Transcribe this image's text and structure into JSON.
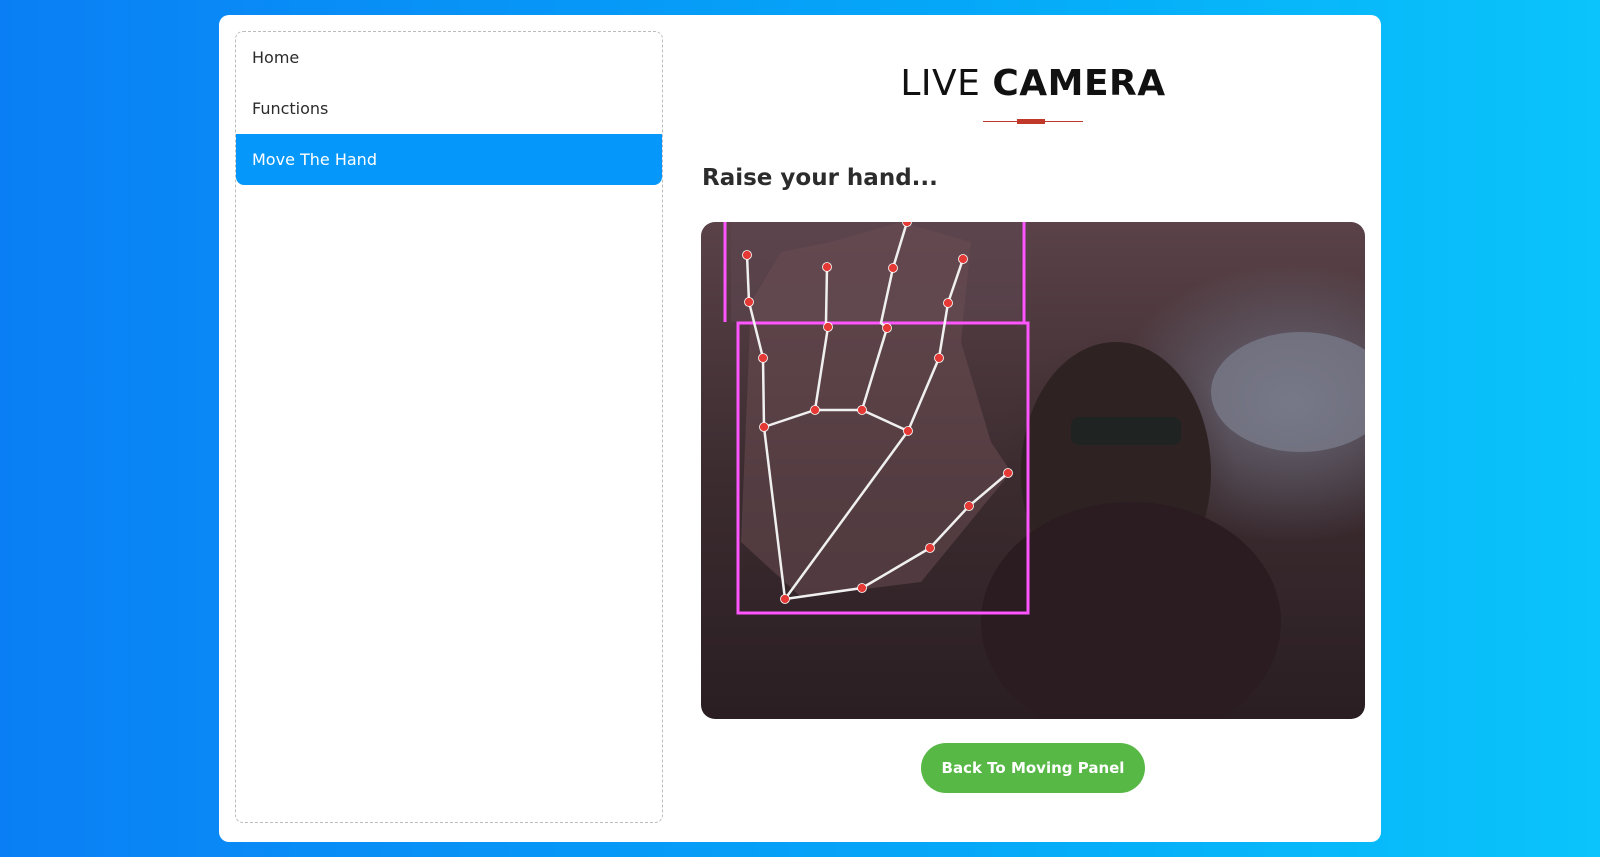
{
  "sidebar": {
    "items": [
      {
        "label": "Home",
        "active": false
      },
      {
        "label": "Functions",
        "active": false
      },
      {
        "label": "Move The Hand",
        "active": true
      }
    ]
  },
  "header": {
    "title_light": "LIVE",
    "title_bold": "CAMERA",
    "accent_color": "#c0392b"
  },
  "main": {
    "prompt": "Raise your hand...",
    "camera": {
      "landmark_color": "#e53935",
      "skeleton_color": "#f0f0f0",
      "bbox_color": "#ff55ff"
    },
    "back_button_label": "Back To Moving Panel",
    "back_button_color": "#57b846"
  },
  "colors": {
    "background_start": "#0a7ff5",
    "background_end": "#0ac4fb",
    "active_item": "#0697fb"
  }
}
